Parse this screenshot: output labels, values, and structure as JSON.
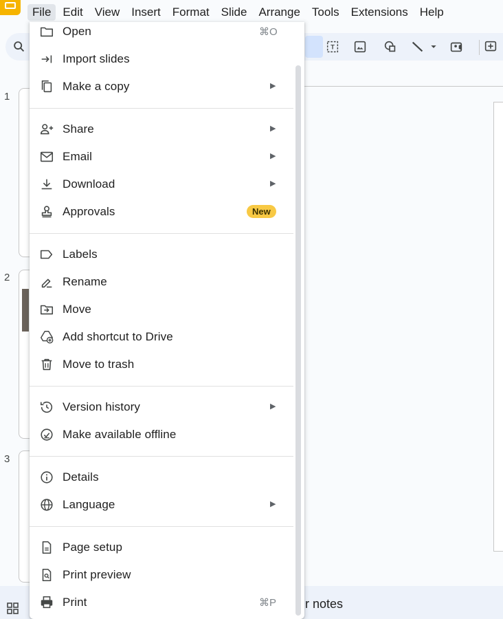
{
  "menubar": {
    "items": [
      "File",
      "Edit",
      "View",
      "Insert",
      "Format",
      "Slide",
      "Arrange",
      "Tools",
      "Extensions",
      "Help"
    ],
    "active": "File"
  },
  "toolbar": {
    "icons": [
      "search-icon",
      "select-icon",
      "text-box-icon",
      "image-icon",
      "shapes-icon",
      "line-icon",
      "dropdown-icon",
      "video-icon",
      "comment-icon"
    ]
  },
  "filmstrip": {
    "slide_numbers": [
      "1",
      "2",
      "3"
    ]
  },
  "bottom_bar": {
    "notes_text": "r notes"
  },
  "file_menu": {
    "open": {
      "label": "Open",
      "shortcut": "⌘O"
    },
    "import_slides": {
      "label": "Import slides"
    },
    "make_copy": {
      "label": "Make a copy"
    },
    "share": {
      "label": "Share"
    },
    "email": {
      "label": "Email"
    },
    "download": {
      "label": "Download"
    },
    "approvals": {
      "label": "Approvals",
      "badge": "New"
    },
    "labels": {
      "label": "Labels"
    },
    "rename": {
      "label": "Rename"
    },
    "move": {
      "label": "Move"
    },
    "add_shortcut": {
      "label": "Add shortcut to Drive"
    },
    "trash": {
      "label": "Move to trash"
    },
    "version_history": {
      "label": "Version history"
    },
    "offline": {
      "label": "Make available offline"
    },
    "details": {
      "label": "Details"
    },
    "language": {
      "label": "Language"
    },
    "page_setup": {
      "label": "Page setup"
    },
    "print_preview": {
      "label": "Print preview"
    },
    "print": {
      "label": "Print",
      "shortcut": "⌘P"
    }
  },
  "colors": {
    "badge": "#f8c944",
    "selected_tool": "#d3e3fd",
    "logo": "#f6b400"
  }
}
